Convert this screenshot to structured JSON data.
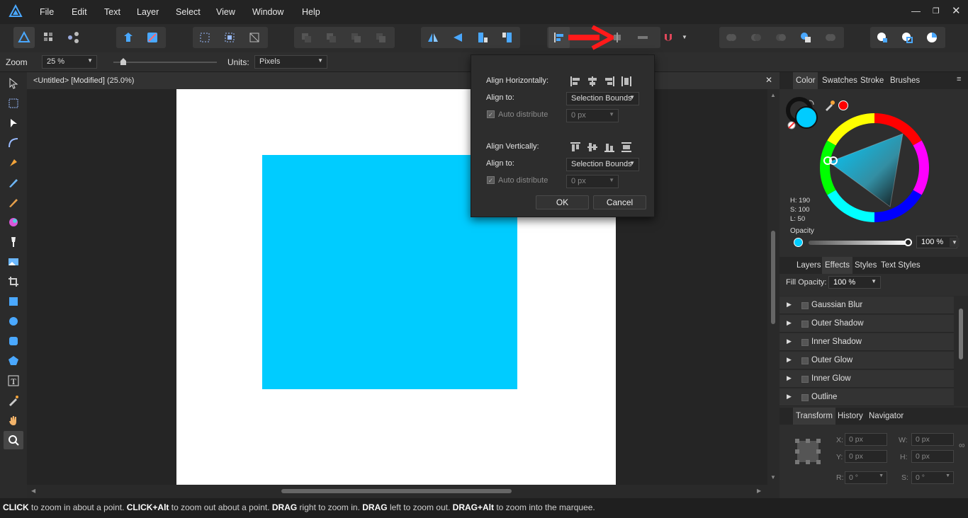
{
  "menubar": {
    "items": [
      "File",
      "Edit",
      "Text",
      "Layer",
      "Select",
      "View",
      "Window",
      "Help"
    ]
  },
  "context": {
    "zoom_label": "Zoom",
    "zoom_value": "25 %",
    "units_label": "Units:",
    "units_value": "Pixels"
  },
  "document": {
    "tab_title": "<Untitled> [Modified] (25.0%)",
    "shape_color": "#00ccff"
  },
  "align_popover": {
    "align_h_label": "Align Horizontally:",
    "align_to_label": "Align to:",
    "align_to_h_value": "Selection Bounds",
    "auto_distribute_label": "Auto distribute",
    "distribute_h_value": "0 px",
    "align_v_label": "Align Vertically:",
    "align_to_v_value": "Selection Bounds",
    "distribute_v_value": "0 px",
    "ok_label": "OK",
    "cancel_label": "Cancel"
  },
  "color_panel": {
    "tabs": [
      "Color",
      "Swatches",
      "Stroke",
      "Brushes"
    ],
    "h": "H: 190",
    "s": "S: 100",
    "l": "L: 50",
    "opacity_label": "Opacity",
    "opacity_value": "100 %",
    "fill_color": "#00ccff",
    "stroke_swatch_color": "#ff0000"
  },
  "effects_panel": {
    "tabs": [
      "Layers",
      "Effects",
      "Styles",
      "Text Styles"
    ],
    "fill_opacity_label": "Fill Opacity:",
    "fill_opacity_value": "100 %",
    "effects": [
      "Gaussian Blur",
      "Outer Shadow",
      "Inner Shadow",
      "Outer Glow",
      "Inner Glow",
      "Outline"
    ]
  },
  "transform_panel": {
    "tabs": [
      "Transform",
      "History",
      "Navigator"
    ],
    "x_label": "X:",
    "x_value": "0 px",
    "y_label": "Y:",
    "y_value": "0 px",
    "w_label": "W:",
    "w_value": "0 px",
    "h_label": "H:",
    "h_value": "0 px",
    "r_label": "R:",
    "r_value": "0 °",
    "s_label": "S:",
    "s_value": "0 °"
  },
  "status": {
    "k1": "CLICK",
    "t1": " to zoom in about a point. ",
    "k2": "CLICK+Alt",
    "t2": " to zoom out about a point. ",
    "k3": "DRAG",
    "t3": " right to zoom in. ",
    "k4": "DRAG",
    "t4": " left to zoom out. ",
    "k5": "DRAG+Alt",
    "t5": " to zoom into the marquee."
  }
}
